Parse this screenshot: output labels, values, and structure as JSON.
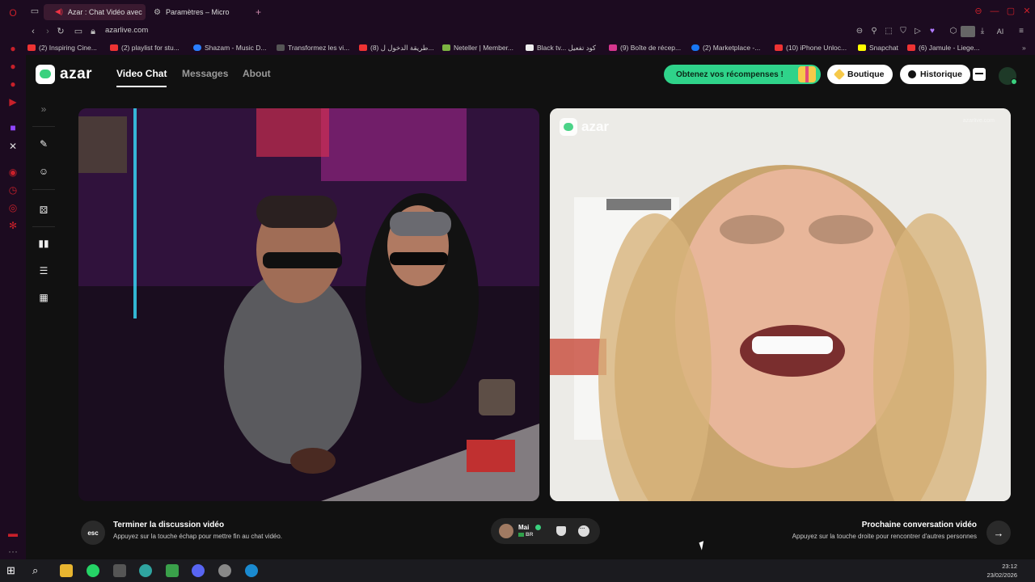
{
  "browser": {
    "tabs": [
      {
        "label": "Azar : Chat Vidéo avec",
        "active": true
      },
      {
        "label": "Paramètres – Micro",
        "active": false
      }
    ],
    "new_tab_symbol": "+",
    "url": "azarlive.com",
    "ai_label": "AI",
    "bookmarks": [
      "(2) Inspiring Cine...",
      "(2) playlist for stu...",
      "Shazam - Music D...",
      "Transformez les vi...",
      "(8) طريقة الدخول ل...",
      "Neteller | Member...",
      "Black tv... كود تفعيل",
      "(9) Boîte de récep...",
      "(2) Marketplace -...",
      "(10) iPhone Unloc...",
      "Snapchat",
      "(6) Jamule - Liege..."
    ]
  },
  "app": {
    "logo_text": "azar",
    "nav": {
      "video_chat": "Video Chat",
      "messages": "Messages",
      "about": "About"
    },
    "reward_button": "Obtenez vos récompenses !",
    "boutique_button": "Boutique",
    "historique_button": "Historique",
    "watermark_text": "azar",
    "watermark_small": "azarlive.com"
  },
  "controls": {
    "esc_key": "esc",
    "end_title": "Terminer la discussion vidéo",
    "end_sub": "Appuyez sur la touche échap pour mettre fin au chat vidéo.",
    "next_title": "Prochaine conversation vidéo",
    "next_sub": "Appuyez sur la touche droite pour rencontrer d'autres personnes",
    "next_arrow": "→"
  },
  "partner": {
    "name": "Mai",
    "country": "BR"
  },
  "taskbar": {
    "time": "23:12",
    "date": "23/02/2026"
  },
  "colors": {
    "brand_green": "#3ad17e",
    "reward_green": "#2fd38a",
    "opera_red": "#c8202a"
  }
}
